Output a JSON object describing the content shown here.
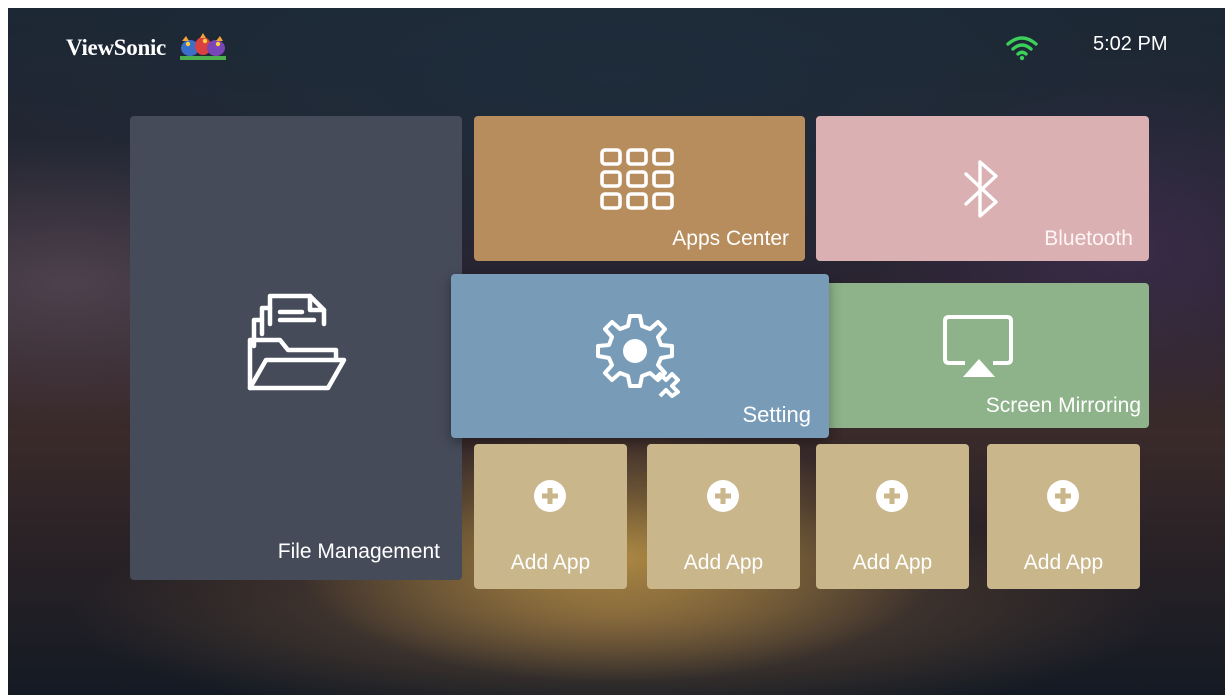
{
  "header": {
    "brand_name": "ViewSonic",
    "wifi_icon": "wifi-icon",
    "wifi_color": "#3ccf5a",
    "time": "5:02 PM"
  },
  "tiles": {
    "file_management": {
      "label": "File Management",
      "icon": "folder-documents-icon",
      "color": "#464b5a"
    },
    "apps_center": {
      "label": "Apps Center",
      "icon": "app-grid-icon",
      "color": "#b78d5d"
    },
    "bluetooth": {
      "label": "Bluetooth",
      "icon": "bluetooth-icon",
      "color": "#dbb0b2"
    },
    "setting": {
      "label": "Setting",
      "icon": "gear-icon",
      "color": "#789cb8",
      "focused": true
    },
    "screen_mirroring": {
      "label": "Screen Mirroring",
      "icon": "screen-mirroring-icon",
      "color": "#8eb28a"
    },
    "add_apps": [
      {
        "label": "Add App",
        "icon": "plus-circle-icon"
      },
      {
        "label": "Add App",
        "icon": "plus-circle-icon"
      },
      {
        "label": "Add App",
        "icon": "plus-circle-icon"
      },
      {
        "label": "Add App",
        "icon": "plus-circle-icon"
      }
    ],
    "add_app_color": "#c9b68a"
  }
}
